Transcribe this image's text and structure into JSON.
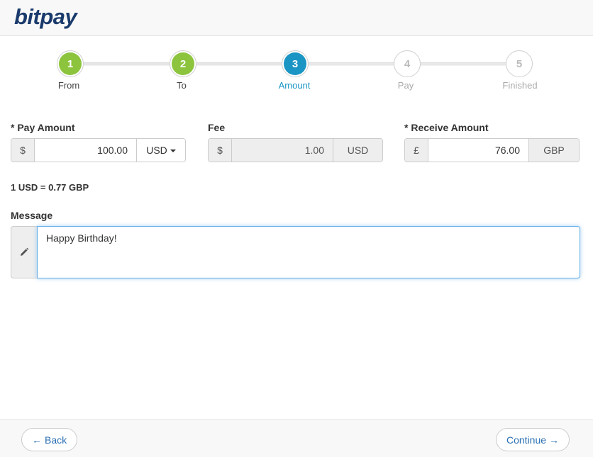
{
  "header": {
    "logo": "bitpay"
  },
  "stepper": {
    "steps": [
      {
        "number": "1",
        "label": "From",
        "state": "done"
      },
      {
        "number": "2",
        "label": "To",
        "state": "done"
      },
      {
        "number": "3",
        "label": "Amount",
        "state": "active"
      },
      {
        "number": "4",
        "label": "Pay",
        "state": "pending"
      },
      {
        "number": "5",
        "label": "Finished",
        "state": "pending"
      }
    ]
  },
  "form": {
    "pay_amount": {
      "label": "* Pay Amount",
      "symbol": "$",
      "value": "100.00",
      "currency": "USD"
    },
    "fee": {
      "label": "Fee",
      "symbol": "$",
      "value": "1.00",
      "currency": "USD"
    },
    "receive_amount": {
      "label": "* Receive Amount",
      "symbol": "£",
      "value": "76.00",
      "currency": "GBP"
    },
    "rate": "1 USD = 0.77 GBP",
    "message": {
      "label": "Message",
      "value": "Happy Birthday!"
    }
  },
  "footer": {
    "back_label": "Back",
    "continue_label": "Continue"
  },
  "colors": {
    "brand": "#1a3a6c",
    "step_done": "#8cc43d",
    "step_active": "#1a95c4",
    "link": "#2a6fb3"
  }
}
